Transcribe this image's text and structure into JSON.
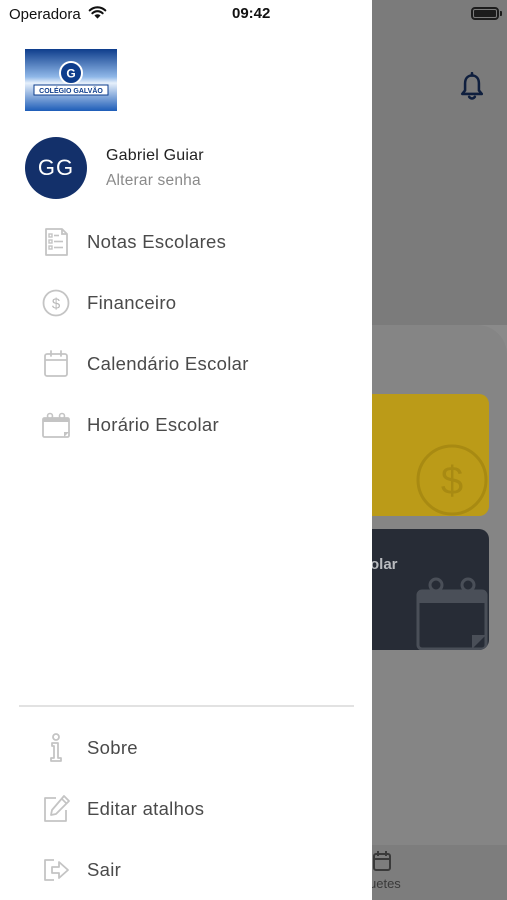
{
  "status_bar": {
    "carrier": "Operadora",
    "time": "09:42"
  },
  "user": {
    "initials": "GG",
    "name": "Gabriel Guiar",
    "change_password": "Alterar senha"
  },
  "logo": {
    "text": "COLÉGIO GALVÃO"
  },
  "menu": {
    "items": [
      {
        "label": "Notas Escolares",
        "icon": "report-card-icon"
      },
      {
        "label": "Financeiro",
        "icon": "dollar-circle-icon"
      },
      {
        "label": "Calendário Escolar",
        "icon": "calendar-icon"
      },
      {
        "label": "Horário Escolar",
        "icon": "schedule-icon"
      }
    ],
    "footer_items": [
      {
        "label": "Sobre",
        "icon": "info-icon"
      },
      {
        "label": "Editar atalhos",
        "icon": "edit-icon"
      },
      {
        "label": "Sair",
        "icon": "logout-icon"
      }
    ]
  },
  "background": {
    "card_label": "olar",
    "tab_label": "uetes"
  },
  "colors": {
    "avatar_bg": "#13306a",
    "accent_yellow": "#bb9b18",
    "dark_card": "#272c36",
    "menu_text": "#4a4a4a",
    "icon_stroke": "#c4c4c4"
  }
}
